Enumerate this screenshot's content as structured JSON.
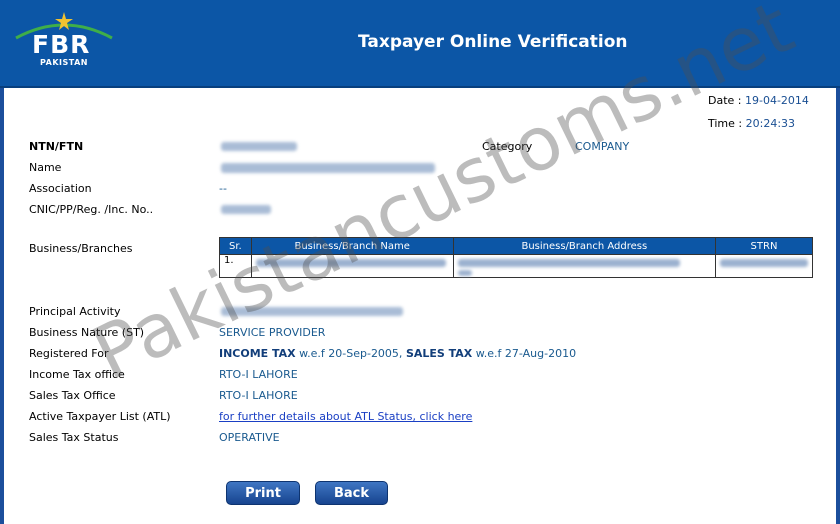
{
  "header": {
    "logo_text": "FBR",
    "logo_sub": "PAKISTAN",
    "title": "Taxpayer Online Verification",
    "colors": {
      "header_bg": "#0c56a6",
      "frame": "#1c4f9c"
    }
  },
  "meta": {
    "date_label": "Date : ",
    "date_value": "19-04-2014",
    "time_label": "Time : ",
    "time_value": "20:24:33"
  },
  "fields": {
    "ntn_label": "NTN/FTN",
    "category_label": "Category",
    "category_value": "COMPANY",
    "name_label": "Name",
    "association_label": "Association",
    "association_value": "--",
    "cnic_label": "CNIC/PP/Reg. /Inc. No..",
    "branches_label": "Business/Branches",
    "principal_label": "Principal Activity",
    "nature_label": "Business Nature (ST)",
    "nature_value": "SERVICE PROVIDER",
    "registered_label": "Registered For",
    "registered": {
      "tax1": "INCOME TAX",
      "tax1_date": " w.e.f 20-Sep-2005, ",
      "tax2": "SALES TAX",
      "tax2_date": " w.e.f 27-Aug-2010"
    },
    "it_office_label": "Income Tax office",
    "it_office_value": "RTO-I LAHORE",
    "st_office_label": "Sales Tax Office",
    "st_office_value": "RTO-I LAHORE",
    "atl_label": "Active Taxpayer List (ATL)",
    "atl_link": "for further details about ATL Status, click here",
    "st_status_label": "Sales Tax Status",
    "st_status_value": "OPERATIVE"
  },
  "branches_table": {
    "columns": [
      "Sr.",
      "Business/Branch Name",
      "Business/Branch Address",
      "STRN"
    ],
    "rows": [
      {
        "sr": "1."
      }
    ]
  },
  "buttons": {
    "print": "Print",
    "back": "Back"
  },
  "watermark": "Pakistancustoms.net"
}
